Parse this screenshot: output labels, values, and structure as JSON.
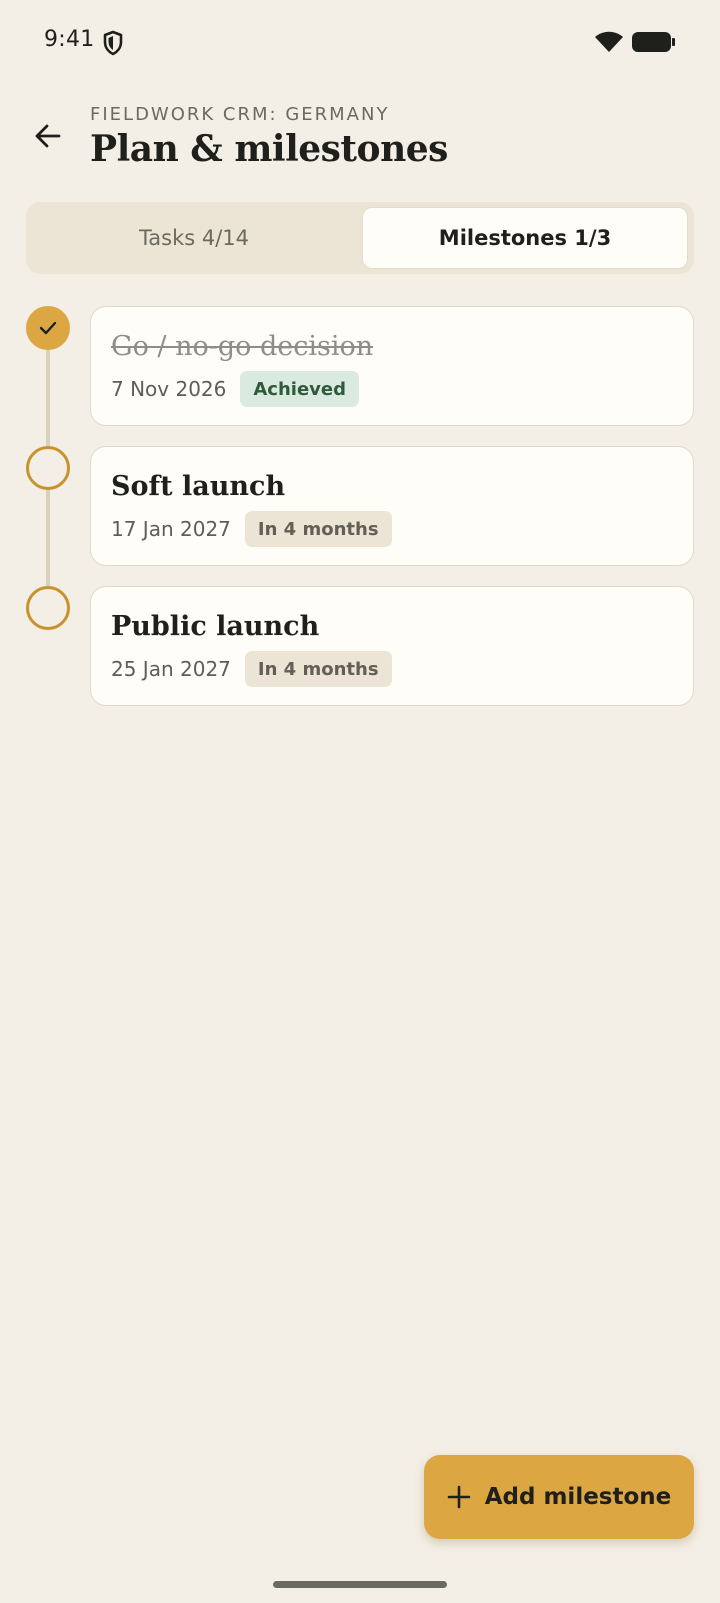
{
  "status_bar": {
    "time": "9:41",
    "icons": [
      "shield-icon",
      "wifi-icon",
      "battery-icon"
    ]
  },
  "header": {
    "eyebrow": "FIELDWORK CRM: GERMANY",
    "title": "Plan & milestones",
    "back_icon": "arrow-left-icon"
  },
  "tabs": [
    {
      "label": "Tasks 4/14",
      "selected": false
    },
    {
      "label": "Milestones 1/3",
      "selected": true
    }
  ],
  "milestones": [
    {
      "title": "Go / no-go decision",
      "date": "7 Nov 2026",
      "badge": "Achieved",
      "done": true
    },
    {
      "title": "Soft launch",
      "date": "17 Jan 2027",
      "badge": "In 4 months",
      "done": false
    },
    {
      "title": "Public launch",
      "date": "25 Jan 2027",
      "badge": "In 4 months",
      "done": false
    }
  ],
  "fab": {
    "label": "Add milestone",
    "icon": "plus-icon"
  },
  "colors": {
    "background": "#f4efe6",
    "accent": "#dca743",
    "achieved_badge_bg": "#dbeadf",
    "achieved_badge_text": "#2f5a3c"
  }
}
